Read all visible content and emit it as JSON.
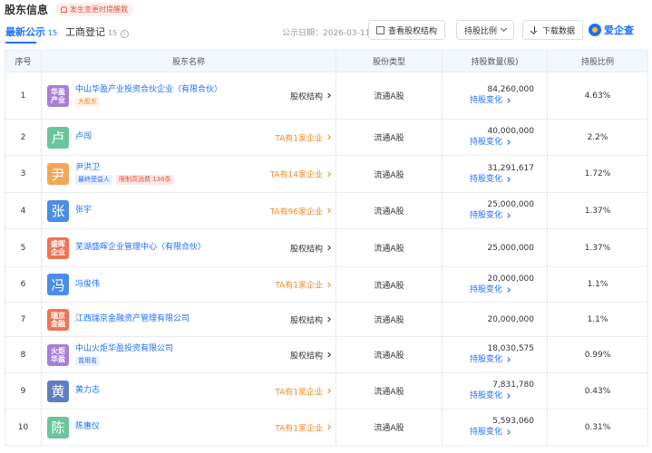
{
  "header": {
    "title": "股东信息",
    "notify": "发生变更时提醒我"
  },
  "tabs": [
    {
      "label": "最新公示",
      "count": "15"
    },
    {
      "label": "工商登记",
      "count": "15"
    }
  ],
  "toolbar": {
    "pub_date": "公示日期：2026-03-11",
    "equity_btn": "查看股权结构",
    "ratio_btn": "持股比例",
    "download_btn": "下载数据",
    "logo": "爱企查"
  },
  "colors": {
    "accent": "#1a6fff",
    "avatar_purple": "#a77fd6",
    "avatar_green": "#6cc49b",
    "avatar_orange": "#f4a657",
    "avatar_blue": "#4a8de8",
    "avatar_red": "#f07355",
    "avatar_navy": "#5f7fc2"
  },
  "table": {
    "columns": [
      "序号",
      "股东名称",
      "股份类型",
      "持股数量(股)",
      "持股比例"
    ],
    "rows": [
      {
        "idx": "1",
        "avatar": "华盈产业",
        "avatar_color": "#a77fd6",
        "name": "中山华盈产业投资合伙企业（有限合伙）",
        "tags": [
          {
            "text": "大股东",
            "style": "orange"
          }
        ],
        "right": "股权结构",
        "right_style": "dark",
        "type": "流通A股",
        "qty": "84,260,000",
        "change": "持股变化",
        "ratio": "4.63%"
      },
      {
        "idx": "2",
        "avatar": "卢",
        "avatar_color": "#6cc49b",
        "name": "卢闯",
        "tags": [],
        "right": "TA有1家企业",
        "right_style": "orange",
        "type": "流通A股",
        "qty": "40,000,000",
        "change": "持股变化",
        "ratio": "2.2%"
      },
      {
        "idx": "3",
        "avatar": "尹",
        "avatar_color": "#f4a657",
        "name": "尹洪卫",
        "tags": [
          {
            "text": "最终受益人",
            "style": "blue"
          },
          {
            "text": "限制高消费 136条",
            "style": "red"
          }
        ],
        "right": "TA有14家企业",
        "right_style": "orange",
        "type": "流通A股",
        "qty": "31,291,617",
        "change": "持股变化",
        "ratio": "1.72%"
      },
      {
        "idx": "4",
        "avatar": "张",
        "avatar_color": "#4a8de8",
        "name": "张宇",
        "tags": [],
        "right": "TA有96家企业",
        "right_style": "orange",
        "type": "流通A股",
        "qty": "25,000,000",
        "change": "持股变化",
        "ratio": "1.37%"
      },
      {
        "idx": "5",
        "avatar": "盛晖企业",
        "avatar_color": "#f07355",
        "name": "芜湖盛晖企业管理中心（有限合伙）",
        "tags": [],
        "right": "股权结构",
        "right_style": "dark",
        "type": "流通A股",
        "qty": "25,000,000",
        "change": "",
        "ratio": "1.37%"
      },
      {
        "idx": "6",
        "avatar": "冯",
        "avatar_color": "#4a8de8",
        "name": "冯俊伟",
        "tags": [],
        "right": "TA有1家企业",
        "right_style": "orange",
        "type": "流通A股",
        "qty": "20,000,000",
        "change": "持股变化",
        "ratio": "1.1%"
      },
      {
        "idx": "7",
        "avatar": "瑞京金融",
        "avatar_color": "#f07355",
        "name": "江西瑞京金融资产管理有限公司",
        "tags": [],
        "right": "股权结构",
        "right_style": "dark",
        "type": "流通A股",
        "qty": "20,000,000",
        "change": "",
        "ratio": "1.1%"
      },
      {
        "idx": "8",
        "avatar": "火炬华盈",
        "avatar_color": "#a77fd6",
        "name": "中山火炬华盈投资有限公司",
        "tags": [
          {
            "text": "曾用名",
            "style": "blue"
          }
        ],
        "right": "股权结构",
        "right_style": "dark",
        "type": "流通A股",
        "qty": "18,030,575",
        "change": "持股变化",
        "ratio": "0.99%"
      },
      {
        "idx": "9",
        "avatar": "黄",
        "avatar_color": "#5f7fc2",
        "name": "黄力志",
        "tags": [],
        "right": "TA有1家企业",
        "right_style": "orange",
        "type": "流通A股",
        "qty": "7,831,780",
        "change": "持股变化",
        "ratio": "0.43%"
      },
      {
        "idx": "10",
        "avatar": "陈",
        "avatar_color": "#6cc49b",
        "name": "陈惠仪",
        "tags": [],
        "right": "TA有1家企业",
        "right_style": "orange",
        "type": "流通A股",
        "qty": "5,593,060",
        "change": "持股变化",
        "ratio": "0.31%"
      }
    ]
  }
}
